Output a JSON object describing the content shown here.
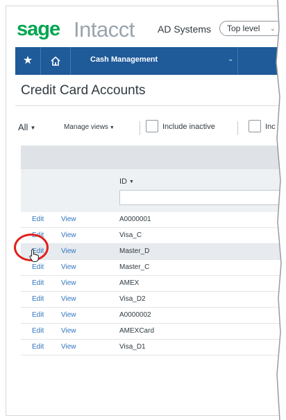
{
  "brand": {
    "logo_primary": "sage",
    "logo_secondary": "Intacct",
    "company": "AD Systems",
    "level": "Top level"
  },
  "nav": {
    "menu_label": "Cash Management",
    "icons": [
      "star-icon",
      "home-icon",
      "chevron-down-icon"
    ]
  },
  "page": {
    "title": "Credit Card Accounts"
  },
  "filters": {
    "all_label": "All",
    "views_label": "Manage views",
    "include_inactive_label": "Include inactive",
    "second_checkbox_label": "Inc"
  },
  "table": {
    "id_header": "ID",
    "row_action_edit": "Edit",
    "row_action_view": "View",
    "rows": [
      {
        "id": "A0000001"
      },
      {
        "id": "Visa_C"
      },
      {
        "id": "Master_D"
      },
      {
        "id": "Master_C"
      },
      {
        "id": "AMEX"
      },
      {
        "id": "Visa_D2"
      },
      {
        "id": "A0000002"
      },
      {
        "id": "AMEXCard"
      },
      {
        "id": "Visa_D1"
      }
    ]
  },
  "colors": {
    "brand_green": "#00a650",
    "nav_blue": "#1f5a99",
    "link_blue": "#2f74c0",
    "highlight_red": "#e0201b"
  }
}
